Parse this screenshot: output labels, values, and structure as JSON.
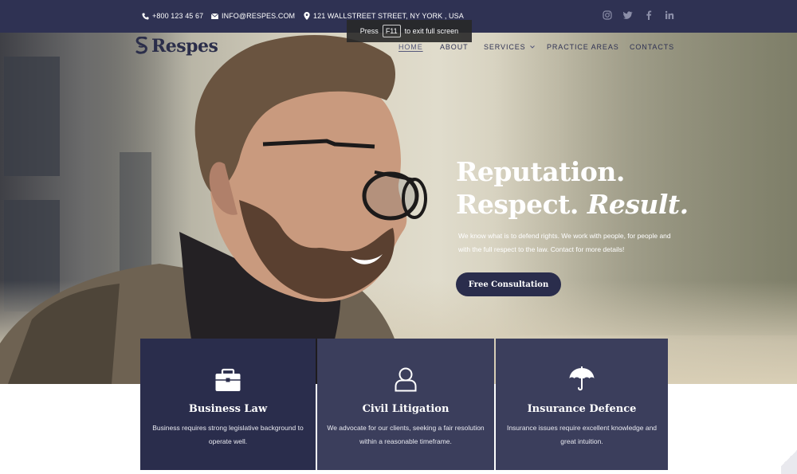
{
  "topbar": {
    "phone": "+800 123 45 67",
    "email": "INFO@RESPES.COM",
    "address": "121 WALLSTREET STREET, NY YORK , USA",
    "socials": [
      "instagram-icon",
      "twitter-icon",
      "facebook-icon",
      "linkedin-icon"
    ]
  },
  "logo": {
    "text": "Respes"
  },
  "fullscreen_hint": {
    "prefix": "Press",
    "key": "F11",
    "suffix": "to exit full screen"
  },
  "nav": {
    "items": [
      {
        "label": "HOME",
        "active": true
      },
      {
        "label": "ABOUT"
      },
      {
        "label": "SERVICES",
        "has_dropdown": true
      },
      {
        "label": "PRACTICE AREAS"
      },
      {
        "label": "CONTACTS"
      }
    ]
  },
  "hero": {
    "title_line1": "Reputation.",
    "title_line2_plain": "Respect.",
    "title_line2_italic": "Result.",
    "description": "We know what is to defend rights. We work with people, for people and with the full respect to the law. Contact for more details!",
    "cta_label": "Free Consultation"
  },
  "services": [
    {
      "icon": "briefcase-icon",
      "title": "Business Law",
      "desc": "Business requires strong legislative background to operate well."
    },
    {
      "icon": "user-icon",
      "title": "Civil Litigation",
      "desc": "We advocate for our clients, seeking a fair resolution within a reasonable timeframe."
    },
    {
      "icon": "umbrella-icon",
      "title": "Insurance Defence",
      "desc": "Insurance issues require excellent knowledge and great intuition."
    }
  ],
  "colors": {
    "navy": "#2f3253",
    "card_dark": "#2a2d4c",
    "card": "#3b3e5c",
    "white": "#ffffff"
  }
}
